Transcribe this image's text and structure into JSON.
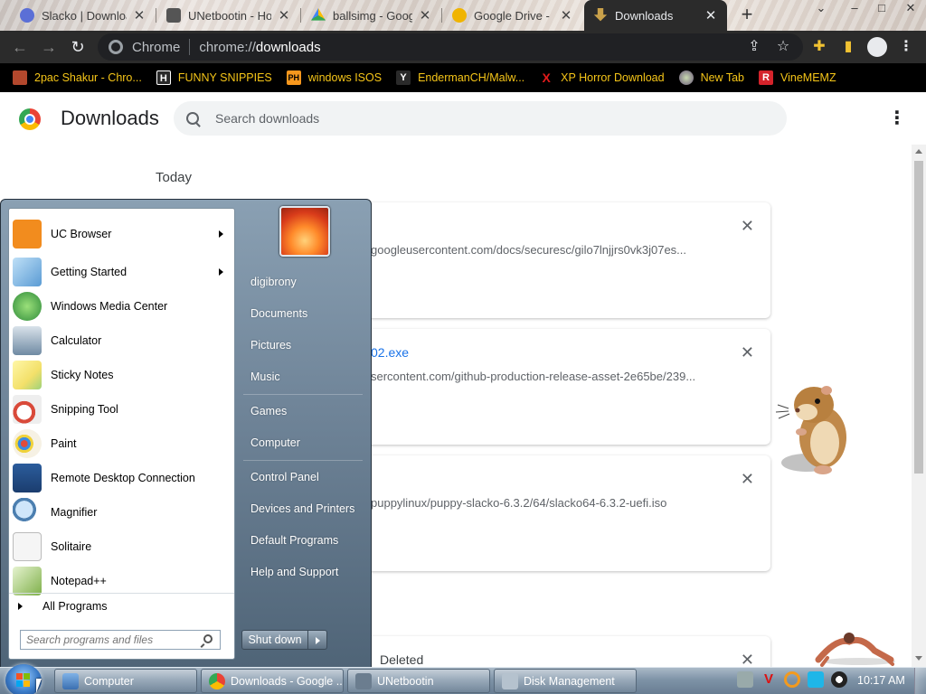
{
  "window": {
    "tabs": [
      {
        "label": "Slacko | Download",
        "icon": "slacko-icon"
      },
      {
        "label": "UNetbootin - Ho",
        "icon": "unetbootin-icon"
      },
      {
        "label": "ballsimg - Goog",
        "icon": "google-drive-icon"
      },
      {
        "label": "Google Drive - D",
        "icon": "google-drive-icon"
      },
      {
        "label": "Downloads",
        "icon": "download-icon",
        "active": true
      }
    ],
    "controls": {
      "minimize": "–",
      "maximize": "□",
      "close": "✕"
    }
  },
  "toolbar": {
    "omnibox_site": "Chrome",
    "omnibox_url_prefix": "chrome://",
    "omnibox_url_rest": "downloads"
  },
  "bookmarks": [
    {
      "label": "2pac Shakur - Chro...",
      "icon_text": "",
      "color": "#b3482d"
    },
    {
      "label": "FUNNY SNIPPIES",
      "icon_text": "H",
      "color": "#2a2a2a"
    },
    {
      "label": "windows ISOS",
      "icon_text": "PH",
      "color": "#f7971d"
    },
    {
      "label": "EndermanCH/Malw...",
      "icon_text": "Y",
      "color": "#2a2a2a"
    },
    {
      "label": "XP Horror Download",
      "icon_text": "X",
      "color": "#000"
    },
    {
      "label": "New Tab",
      "icon_text": "",
      "color": "#7a6"
    },
    {
      "label": "VineMEMZ",
      "icon_text": "R",
      "color": "#d4232b"
    }
  ],
  "downloads_page": {
    "title": "Downloads",
    "search_placeholder": "Search downloads",
    "section_today": "Today",
    "items": [
      {
        "name": "",
        "url": "googleusercontent.com/docs/securesc/gilo7lnjjrs0vk3j07es..."
      },
      {
        "name": "02.exe",
        "url": "sercontent.com/github-production-release-asset-2e65be/239..."
      },
      {
        "name": "",
        "url": "puppylinux/puppy-slacko-6.3.2/64/slacko64-6.3.2-uefi.iso"
      },
      {
        "name": "",
        "url": "",
        "status": "Deleted"
      }
    ]
  },
  "start_menu": {
    "programs": [
      {
        "label": "UC Browser",
        "has_submenu": true,
        "color": "#f28c1e"
      },
      {
        "label": "Getting Started",
        "has_submenu": true,
        "color": "#5a9bd4"
      },
      {
        "label": "Windows Media Center",
        "has_submenu": false,
        "color": "#2e8b3a"
      },
      {
        "label": "Calculator",
        "has_submenu": false,
        "color": "#6f8aa3"
      },
      {
        "label": "Sticky Notes",
        "has_submenu": false,
        "color": "#f3e06a"
      },
      {
        "label": "Snipping Tool",
        "has_submenu": false,
        "color": "#d94a3a"
      },
      {
        "label": "Paint",
        "has_submenu": false,
        "color": "#f0a830"
      },
      {
        "label": "Remote Desktop Connection",
        "has_submenu": false,
        "color": "#2f6fb6"
      },
      {
        "label": "Magnifier",
        "has_submenu": false,
        "color": "#4c7fb0"
      },
      {
        "label": "Solitaire",
        "has_submenu": false,
        "color": "#e8e8e8"
      },
      {
        "label": "Notepad++",
        "has_submenu": false,
        "color": "#7fb04a"
      }
    ],
    "all_programs": "All Programs",
    "search_placeholder": "Search programs and files",
    "right_items": [
      "digibrony",
      "Documents",
      "Pictures",
      "Music",
      "Games",
      "Computer",
      "Control Panel",
      "Devices and Printers",
      "Default Programs",
      "Help and Support"
    ],
    "shutdown_label": "Shut down"
  },
  "taskbar": {
    "buttons": [
      {
        "label": "Computer",
        "color": "#3b6fb0"
      },
      {
        "label": "Downloads - Google ...",
        "color": "#4285f4"
      },
      {
        "label": "UNetbootin",
        "color": "#6b7d8f"
      },
      {
        "label": "Disk Management",
        "color": "#8a99a8"
      }
    ],
    "clock": "10:17 AM"
  }
}
